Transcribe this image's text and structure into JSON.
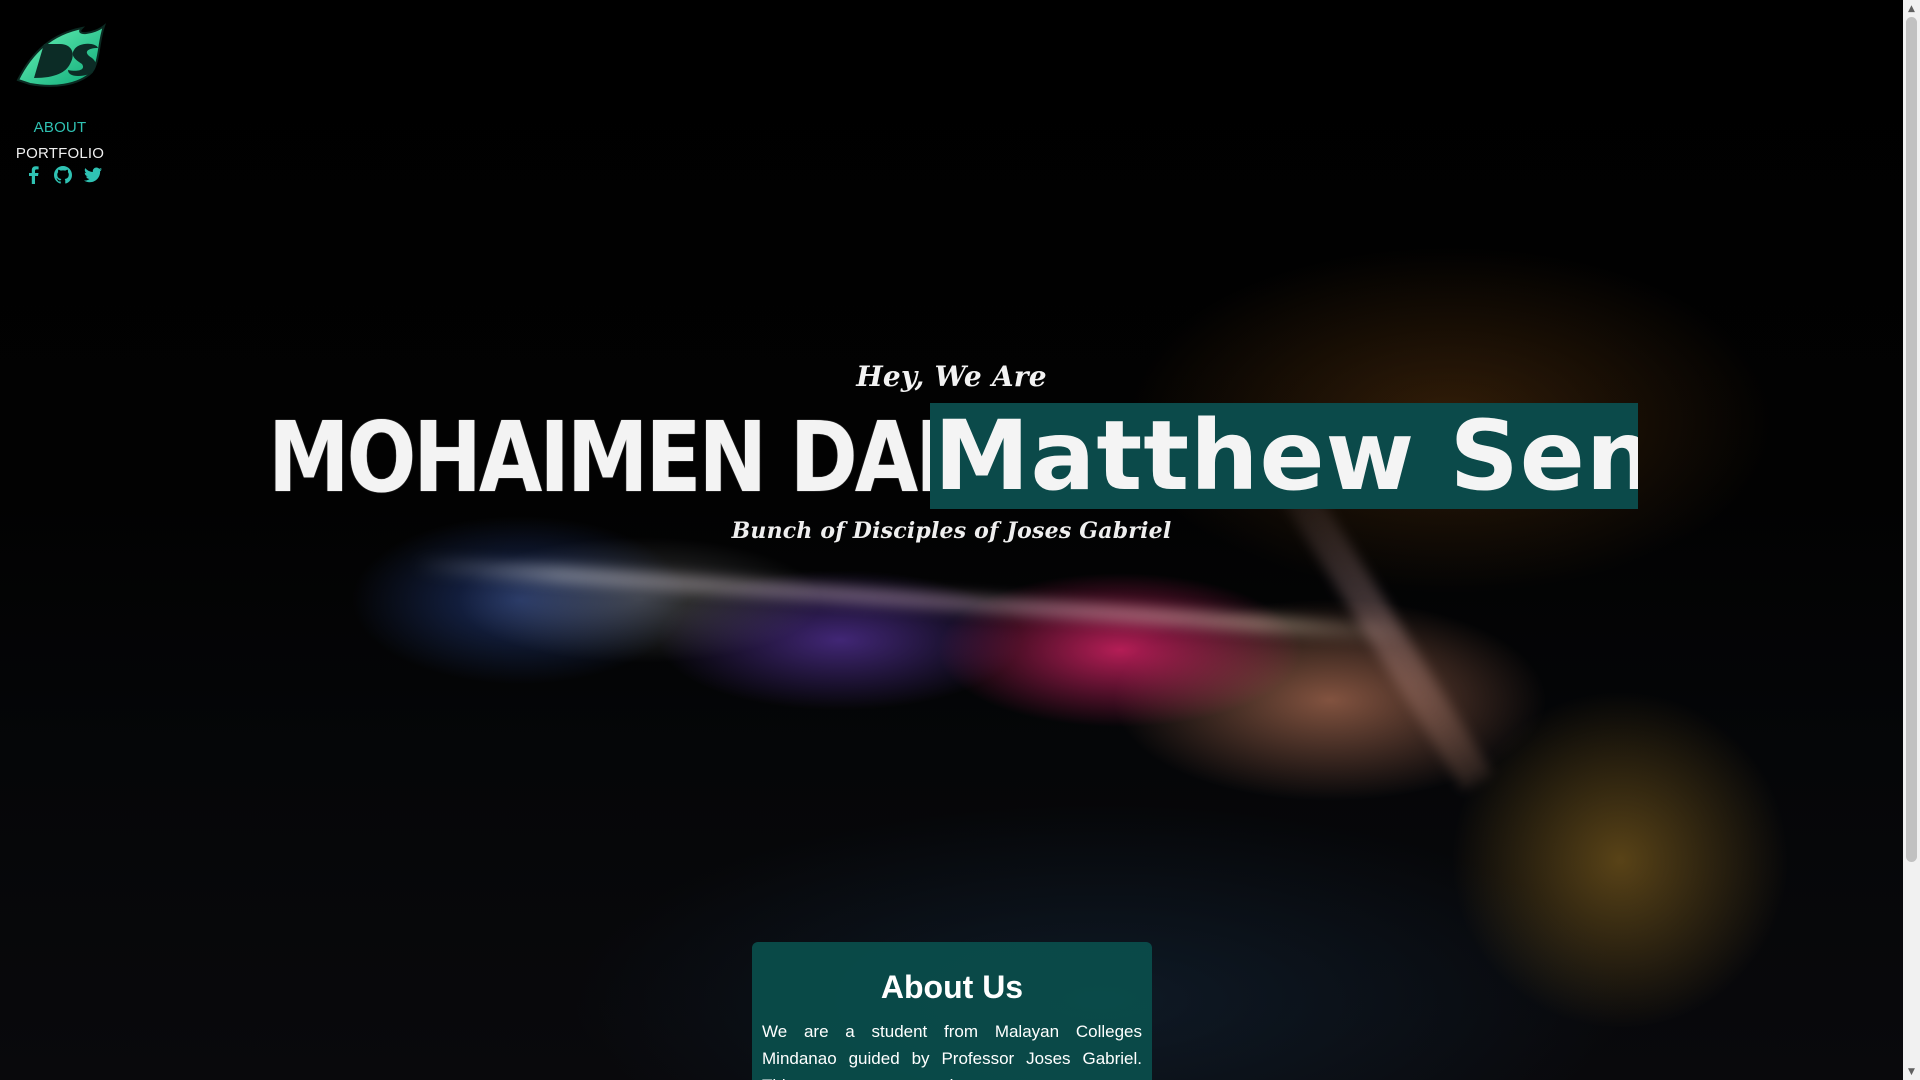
{
  "sidebar": {
    "logo_text": "DS",
    "nav": [
      {
        "label": "ABOUT",
        "active": true
      },
      {
        "label": "PORTFOLIO",
        "active": false
      }
    ],
    "socials": [
      "facebook-icon",
      "github-icon",
      "twitter-icon"
    ]
  },
  "hero": {
    "greeting": "Hey, We Are",
    "name_left": "MOHAIMEN DAMPAC",
    "name_right": "Matthew Senon",
    "tagline": "Bunch of Disciples of Joses Gabriel"
  },
  "about": {
    "title": "About Us",
    "text": "We are a student from Malayan Colleges Mindanao guided by Professor Joses Gabriel. This is our"
  },
  "colors": {
    "accent": "#2fc2b3",
    "highlight_bg": "#0b4a4a",
    "card_bg": "#0a4e4c",
    "background": "#000000"
  }
}
